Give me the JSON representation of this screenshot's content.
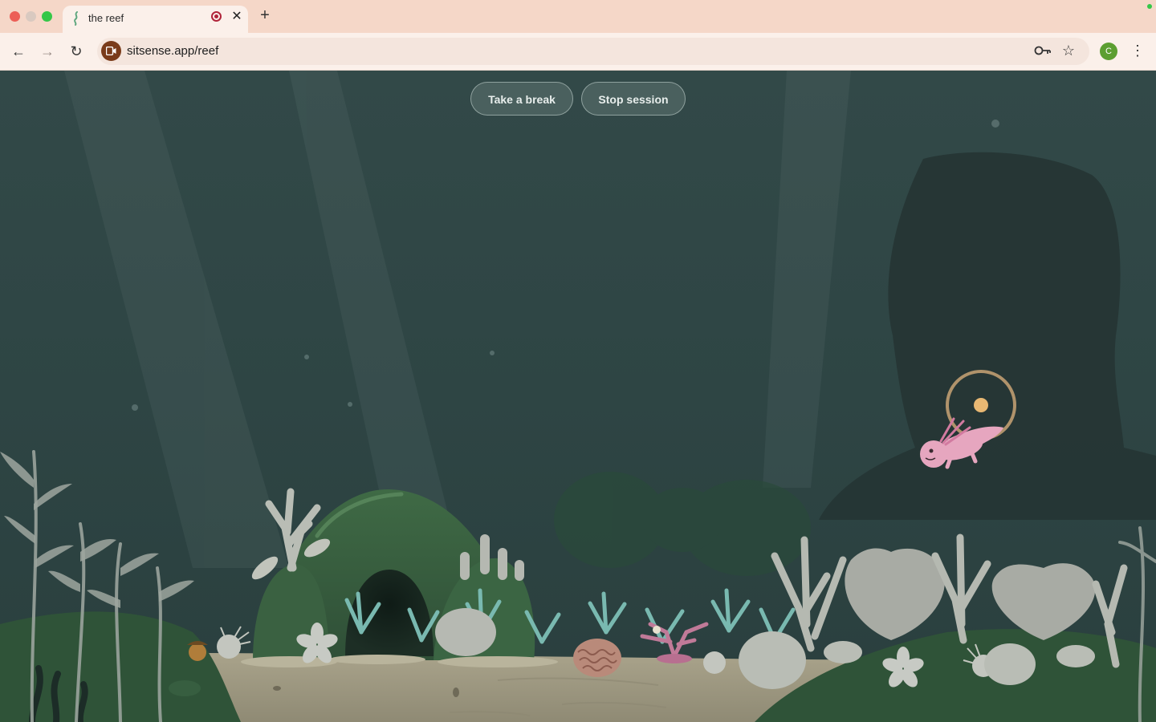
{
  "browser": {
    "tab_title": "the reef",
    "url": "sitsense.app/reef",
    "profile_initial": "C",
    "icons": {
      "tab_favicon": "wave-icon",
      "recording": "recording-icon",
      "close": "close-icon",
      "new_tab": "plus-icon",
      "back": "back-arrow-icon",
      "forward": "forward-arrow-icon",
      "reload": "reload-icon",
      "site": "camera-icon",
      "passwords": "key-icon",
      "bookmark": "star-icon",
      "menu": "kebab-menu-icon"
    }
  },
  "controls": {
    "take_break_label": "Take a break",
    "stop_session_label": "Stop session"
  },
  "colors": {
    "chrome_tab_bar": "#f5d7c8",
    "chrome_toolbar": "#fbf0ea",
    "water_top": "#2f4645",
    "water_bottom": "#2a403f",
    "sand": "#a7a28a",
    "axolotl": "#e6a6bf",
    "ring": "#c9a86a",
    "avatar": "#5c9e31"
  }
}
